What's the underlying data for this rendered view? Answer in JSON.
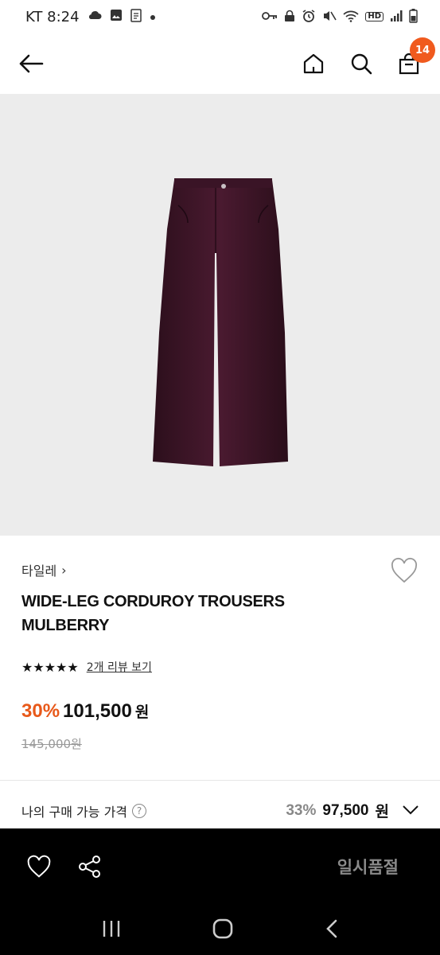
{
  "status_bar": {
    "carrier_time": "KT 8:24",
    "left_icons": [
      "cloud-icon",
      "image-icon",
      "note-icon",
      "dot-icon"
    ],
    "right_icons": [
      "key-icon",
      "lock-icon",
      "alarm-icon",
      "mute-icon",
      "wifi-icon",
      "hd-icon",
      "signal-icon",
      "battery-icon"
    ],
    "hd_label": "HD"
  },
  "nav": {
    "cart_count": "14",
    "accent": "#f05a1e"
  },
  "product": {
    "brand": "타일레",
    "brand_chevron": "›",
    "title": "WIDE-LEG CORDUROY TROUSERS MULBERRY",
    "stars": "★★★★★",
    "review_link": "2개 리뷰 보기",
    "discount": "30%",
    "price": "101,500",
    "currency": "원",
    "original_price": "145,000원",
    "image_color": "#3a1426"
  },
  "my_price": {
    "label": "나의 구매 가능 가격",
    "help": "?",
    "discount": "33%",
    "price": "97,500",
    "currency": "원"
  },
  "action_bar": {
    "status_label": "일시품절"
  }
}
